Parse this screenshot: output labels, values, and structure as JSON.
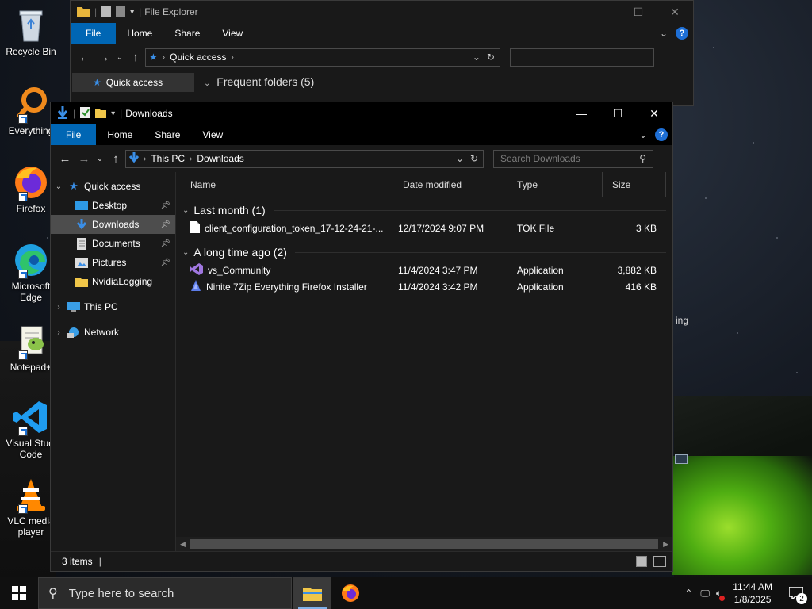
{
  "desktop": {
    "icons": [
      {
        "label": "Recycle Bin"
      },
      {
        "label": "Everything"
      },
      {
        "label": "Firefox"
      },
      {
        "label": "Microsoft Edge"
      },
      {
        "label": "Notepad+"
      },
      {
        "label": "Visual Studi Code"
      },
      {
        "label": "VLC media player"
      }
    ],
    "partial_text": "ing"
  },
  "back_window": {
    "title": "File Explorer",
    "tabs": [
      "File",
      "Home",
      "Share",
      "View"
    ],
    "address": [
      "Quick access"
    ],
    "nav_item": "Quick access",
    "section": "Frequent folders (5)"
  },
  "front_window": {
    "title": "Downloads",
    "tabs": [
      "File",
      "Home",
      "Share",
      "View"
    ],
    "address": [
      "This PC",
      "Downloads"
    ],
    "search_placeholder": "Search Downloads",
    "nav": [
      {
        "label": "Quick access",
        "icon": "star-icon"
      },
      {
        "label": "Desktop",
        "icon": "desktop-icon"
      },
      {
        "label": "Downloads",
        "icon": "download-arrow-icon"
      },
      {
        "label": "Documents",
        "icon": "document-icon"
      },
      {
        "label": "Pictures",
        "icon": "pictures-icon"
      },
      {
        "label": "NvidiaLogging",
        "icon": "folder-icon"
      },
      {
        "label": "This PC",
        "icon": "computer-icon"
      },
      {
        "label": "Network",
        "icon": "network-icon"
      }
    ],
    "columns": [
      "Name",
      "Date modified",
      "Type",
      "Size"
    ],
    "groups": [
      {
        "label": "Last month (1)",
        "rows": [
          {
            "name": "client_configuration_token_17-12-24-21-...",
            "date": "12/17/2024 9:07 PM",
            "type": "TOK File",
            "size": "3 KB",
            "icon": "file-icon"
          }
        ]
      },
      {
        "label": "A long time ago (2)",
        "rows": [
          {
            "name": "vs_Community",
            "date": "11/4/2024 3:47 PM",
            "type": "Application",
            "size": "3,882 KB",
            "icon": "visual-studio-icon"
          },
          {
            "name": "Ninite 7Zip Everything Firefox Installer",
            "date": "11/4/2024 3:42 PM",
            "type": "Application",
            "size": "416 KB",
            "icon": "ninite-icon"
          }
        ]
      }
    ],
    "status": "3 items"
  },
  "taskbar": {
    "search_placeholder": "Type here to search",
    "time": "11:44 AM",
    "date": "1/8/2025",
    "notification_count": "2"
  }
}
